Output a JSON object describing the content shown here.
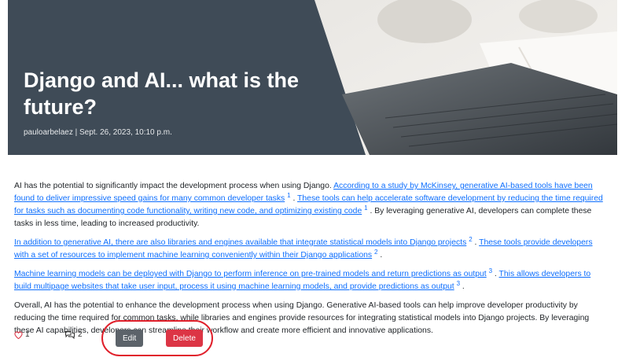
{
  "post": {
    "title": "Django and AI... what is the future?",
    "meta": "pauloarbelaez | Sept. 26, 2023, 10:10 p.m."
  },
  "body": {
    "p1": {
      "t1": "AI has the potential to significantly impact the development process when using Django. ",
      "l1": "According to a study by McKinsey, generative AI-based tools have been found to deliver impressive speed gains for many common developer tasks",
      "s1": "1",
      "t2": " . ",
      "l2": "These tools can help accelerate software development by reducing the time required for tasks such as documenting code functionality, writing new code, and optimizing existing code",
      "s2": "1",
      "t3": " . By leveraging generative AI, developers can complete these tasks in less time, leading to increased productivity."
    },
    "p2": {
      "l1": "In addition to generative AI, there are also libraries and engines available that integrate statistical models into Django projects",
      "s1": "2",
      "t1": " . ",
      "l2": "These tools provide developers with a set of resources to implement machine learning conveniently within their Django applications",
      "s2": "2",
      "t2": " ."
    },
    "p3": {
      "l1": "Machine learning models can be deployed with Django to perform inference on pre-trained models and return predictions as output",
      "s1": "3",
      "t1": " . ",
      "l2": "This allows developers to build multipage websites that take user input, process it using machine learning models, and provide predictions as output",
      "s2": "3",
      "t2": " ."
    },
    "p4": "Overall, AI has the potential to enhance the development process when using Django. Generative AI-based tools can help improve developer productivity by reducing the time required for common tasks, while libraries and engines provide resources for integrating statistical models into Django projects. By leveraging these AI capabilities, developers can streamline their workflow and create more efficient and innovative applications."
  },
  "footer": {
    "likes": "1",
    "comments": "2",
    "edit_label": "Edit",
    "delete_label": "Delete"
  },
  "icons": {
    "like": "heart-icon",
    "comment": "comments-icon"
  },
  "colors": {
    "link": "#0d6efd",
    "hero_bg": "#3f4b57",
    "edit_bg": "#5c636a",
    "delete_bg": "#dc3545",
    "heart": "#dc3545",
    "annotation_ring": "#e0202b"
  }
}
